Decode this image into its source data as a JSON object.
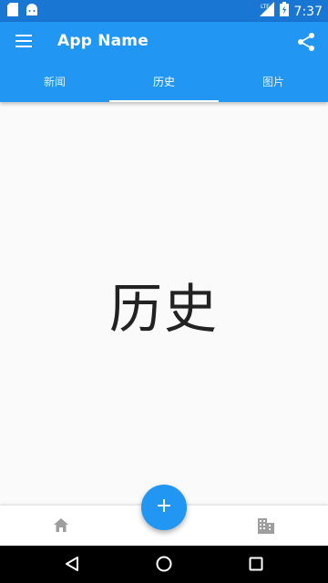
{
  "status_bar": {
    "time": "7:37",
    "network": "LTE",
    "icons": [
      "sd-card-icon",
      "android-icon",
      "signal-icon",
      "battery-icon"
    ]
  },
  "app_bar": {
    "title": "App Name",
    "icons": [
      "menu-icon",
      "share-icon"
    ]
  },
  "tabs": [
    {
      "label": "新闻",
      "active": false
    },
    {
      "label": "历史",
      "active": true
    },
    {
      "label": "图片",
      "active": false
    }
  ],
  "content": {
    "text": "历史"
  },
  "bottom_bar": {
    "icons": [
      "home-icon",
      "building-icon"
    ],
    "fab_icon": "plus-icon"
  },
  "nav_bar": {
    "icons": [
      "back-icon",
      "home-circle-icon",
      "recents-icon"
    ]
  },
  "colors": {
    "primary": "#2196f3",
    "primary_dark": "#1976d2",
    "background": "#fafafa",
    "icon_gray": "#9e9e9e"
  }
}
